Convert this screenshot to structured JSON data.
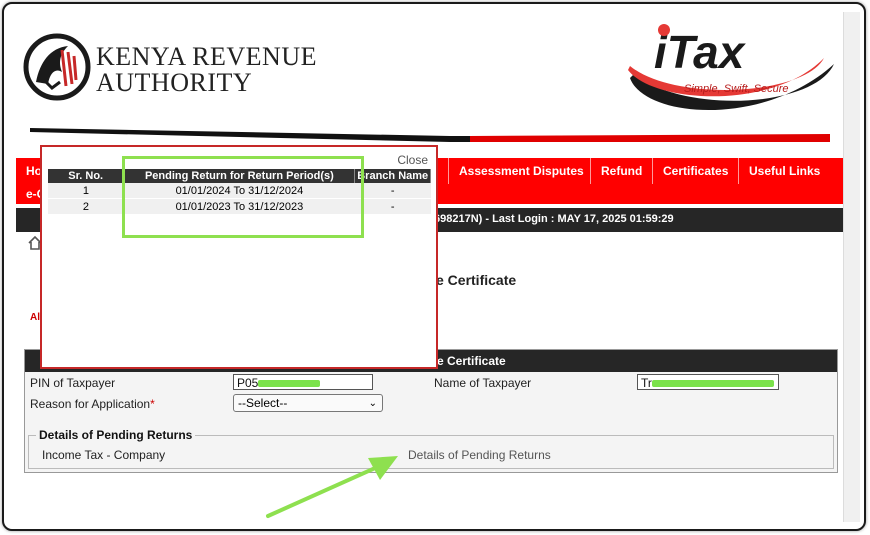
{
  "header": {
    "org_line1": "KENYA REVENUE",
    "org_line2": "AUTHORITY",
    "itax_brand": "iTax",
    "itax_tagline": "Simple, Swift, Secure"
  },
  "menu": {
    "items": [
      "Ho",
      "Assessment Disputes",
      "Refund",
      "Certificates",
      "Useful Links"
    ],
    "sub": "e-C"
  },
  "login_bar": {
    "text": "698217N)  - Last Login : MAY 17, 2025 01:59:29"
  },
  "page": {
    "title_partial": "e Certificate",
    "required_note": "Al"
  },
  "form": {
    "header_partial": "e Certificate",
    "pin_label": "PIN of Taxpayer",
    "pin_value_prefix": "P05",
    "name_label": "Name of Taxpayer",
    "name_value_prefix": "Tr",
    "reason_label": "Reason for Application",
    "reason_required": "*",
    "reason_selected": "--Select--",
    "pending_legend": "Details of Pending Returns",
    "tax_type": "Income Tax - Company",
    "pending_link": "Details of Pending Returns"
  },
  "popup": {
    "close_label": "Close",
    "columns": [
      "Sr. No.",
      "Pending Return for Return Period(s)",
      "Branch Name"
    ],
    "rows": [
      {
        "sr": "1",
        "period": "01/01/2024 To 31/12/2024",
        "branch": "-"
      },
      {
        "sr": "2",
        "period": "01/01/2023 To 31/12/2023",
        "branch": "-"
      }
    ]
  },
  "colors": {
    "menu_red": "#ff0000",
    "dark_bar": "#262626",
    "highlight_green": "#8ee04f",
    "popup_border": "#c62828"
  }
}
